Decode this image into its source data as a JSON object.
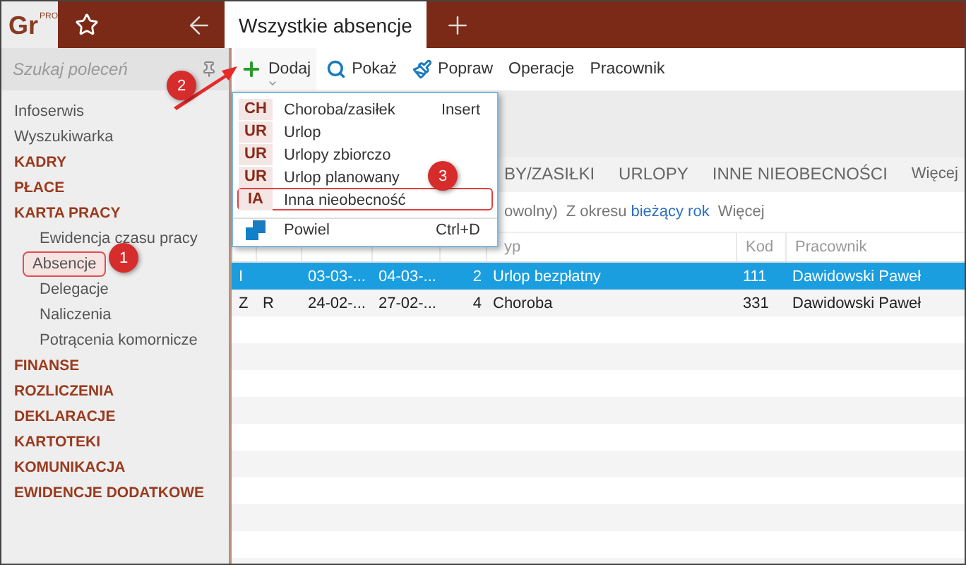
{
  "app": {
    "logo": "Gr",
    "logo_badge": "PRO"
  },
  "document_tabs": [
    {
      "label": "Wszystkie absencje",
      "selected": true
    }
  ],
  "sidebar": {
    "search": {
      "placeholder": "Szukaj poleceń"
    },
    "items": [
      {
        "label": "Infoserwis",
        "kind": "link",
        "selected": false
      },
      {
        "label": "Wyszukiwarka",
        "kind": "link",
        "selected": false
      },
      {
        "label": "KADRY",
        "kind": "section",
        "selected": false
      },
      {
        "label": "PŁACE",
        "kind": "section",
        "selected": false
      },
      {
        "label": "KARTA PRACY",
        "kind": "section",
        "selected": false,
        "children": [
          {
            "label": "Ewidencja czasu pracy",
            "selected": false
          },
          {
            "label": "Absencje",
            "selected": true
          },
          {
            "label": "Delegacje",
            "selected": false
          },
          {
            "label": "Naliczenia",
            "selected": false
          },
          {
            "label": "Potrącenia komornicze",
            "selected": false
          }
        ]
      },
      {
        "label": "FINANSE",
        "kind": "section",
        "selected": false
      },
      {
        "label": "ROZLICZENIA",
        "kind": "section",
        "selected": false
      },
      {
        "label": "DEKLARACJE",
        "kind": "section",
        "selected": false
      },
      {
        "label": "KARTOTEKI",
        "kind": "section",
        "selected": false
      },
      {
        "label": "KOMUNIKACJA",
        "kind": "section",
        "selected": false
      },
      {
        "label": "EWIDENCJE DODATKOWE",
        "kind": "section",
        "selected": false
      }
    ]
  },
  "toolbar": [
    {
      "label": "Dodaj",
      "kind": "add",
      "expanded": true
    },
    {
      "label": "Pokaż",
      "kind": "show",
      "expanded": false
    },
    {
      "label": "Popraw",
      "kind": "edit",
      "expanded": false
    },
    {
      "label": "Operacje",
      "kind": "text",
      "expanded": false
    },
    {
      "label": "Pracownik",
      "kind": "text",
      "expanded": false
    }
  ],
  "add_menu": [
    {
      "kind": "code",
      "code": "CH",
      "label": "Choroba/zasiłek",
      "shortcut": "Insert",
      "highlighted": false
    },
    {
      "kind": "code",
      "code": "UR",
      "label": "Urlop",
      "highlighted": false
    },
    {
      "kind": "code",
      "code": "UR",
      "label": "Urlopy zbiorczo",
      "highlighted": false
    },
    {
      "kind": "code",
      "code": "UR",
      "label": "Urlop planowany",
      "highlighted": false
    },
    {
      "kind": "code",
      "code": "IA",
      "label": "Inna nieobecność",
      "highlighted": true
    },
    {
      "kind": "copy",
      "label": "Powiel",
      "shortcut": "Ctrl+D",
      "highlighted": false
    }
  ],
  "view_tabs": [
    {
      "label": "BY/ZASIŁKI",
      "selected": false
    },
    {
      "label": "URLOPY",
      "selected": false
    },
    {
      "label": "INNE NIEOBECNOŚCI",
      "selected": false
    },
    {
      "label": "Więcej",
      "selected": false
    }
  ],
  "filter": {
    "text_1": "owolny)",
    "text_2": "Z okresu",
    "period": "bieżący rok",
    "more": "Więcej"
  },
  "table": {
    "columns": [
      "",
      "",
      "",
      "",
      "",
      "yp",
      "Kod",
      "Pracownik"
    ],
    "rows": [
      {
        "cells": [
          "I",
          "",
          "03-03-...",
          "04-03-...",
          "2",
          "Urlop bezpłatny",
          "111",
          "Dawidowski Paweł"
        ],
        "selected": true
      },
      {
        "cells": [
          "Z",
          "R",
          "24-02-...",
          "27-02-...",
          "4",
          "Choroba",
          "331",
          "Dawidowski Paweł"
        ],
        "selected": false
      }
    ]
  },
  "callouts": [
    "1",
    "2",
    "3"
  ]
}
